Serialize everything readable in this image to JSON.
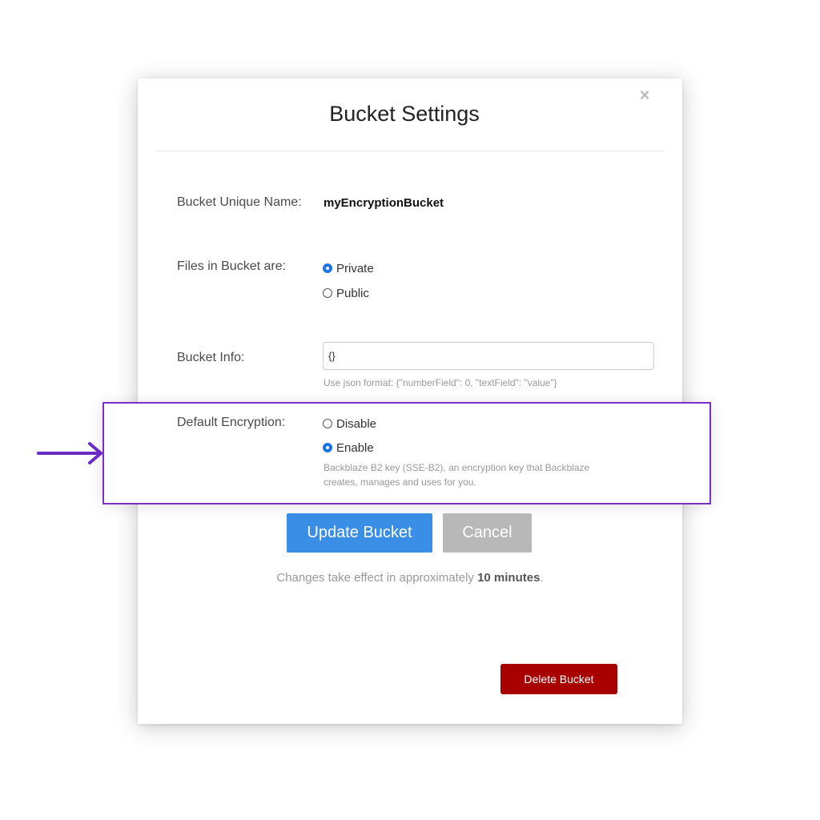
{
  "dialog": {
    "title": "Bucket Settings",
    "close_symbol": "×"
  },
  "bucket_name": {
    "label": "Bucket Unique Name:",
    "value": "myEncryptionBucket"
  },
  "files": {
    "label": "Files in Bucket are:",
    "options": [
      {
        "label": "Private",
        "checked": true
      },
      {
        "label": "Public",
        "checked": false
      }
    ]
  },
  "bucket_info": {
    "label": "Bucket Info:",
    "value": "{}",
    "help": "Use json format: {\"numberField\": 0, \"textField\": \"value\"}"
  },
  "encryption": {
    "label": "Default Encryption:",
    "options": [
      {
        "label": "Disable",
        "checked": false
      },
      {
        "label": "Enable",
        "checked": true
      }
    ],
    "help_line1": "Backblaze B2 key (SSE-B2), an encryption key that Backblaze",
    "help_line2": "creates, manages and uses for you."
  },
  "buttons": {
    "update": "Update Bucket",
    "cancel": "Cancel",
    "delete": "Delete Bucket"
  },
  "note": {
    "prefix": "Changes take effect in approximately ",
    "emphasis": "10 minutes",
    "suffix": "."
  },
  "colors": {
    "accent_blue": "#3a8ee6",
    "highlight_purple": "#7b2fc9",
    "danger_red": "#a80000"
  },
  "icons": {
    "arrow": "arrow-right-icon",
    "close": "close-icon"
  }
}
